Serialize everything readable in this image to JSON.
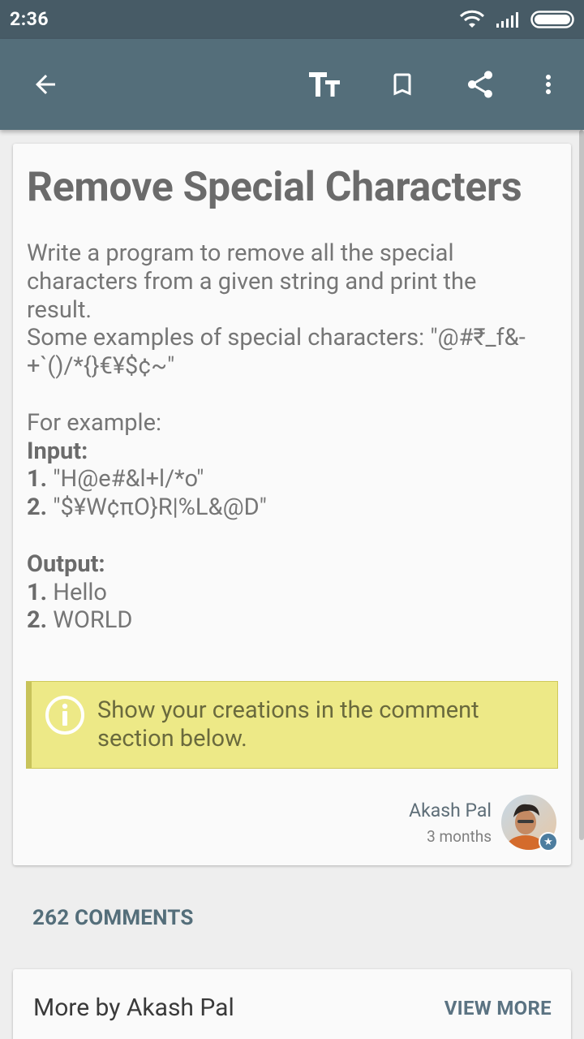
{
  "status_bar": {
    "time": "2:36"
  },
  "toolbar": {
    "back_icon": "arrow-back-icon",
    "text_size_icon": "text-size-icon",
    "bookmark_icon": "bookmark-icon",
    "share_icon": "share-icon",
    "more_icon": "more-vert-icon"
  },
  "lesson": {
    "title": "Remove Special Characters",
    "intro_line_1": "Write a program to remove all the special",
    "intro_line_2": "characters from a given string and print the",
    "intro_line_3": "result.",
    "examples_line_1": "Some examples of special characters: \"@#₹_f&-",
    "examples_line_2": "+`()/*{}€¥$¢~\"",
    "for_example": "For example:",
    "input_label": "Input:",
    "inputs": [
      {
        "num": "1.",
        "value": " \"H@e#&l+l/*o\""
      },
      {
        "num": "2.",
        "value": " \"$¥W¢πO}R|%L&@D\""
      }
    ],
    "output_label": "Output:",
    "outputs": [
      {
        "num": "1.",
        "value": " Hello"
      },
      {
        "num": "2.",
        "value": " WORLD"
      }
    ],
    "note": "Show your creations in the comment section below.",
    "author": "Akash Pal",
    "posted": "3 months"
  },
  "comments_label": "262 COMMENTS",
  "more_by": {
    "title": "More by Akash Pal",
    "action": "VIEW MORE"
  },
  "colors": {
    "toolbar": "#546e7a",
    "status_bar": "#475b66",
    "note_bg": "#ede987"
  }
}
